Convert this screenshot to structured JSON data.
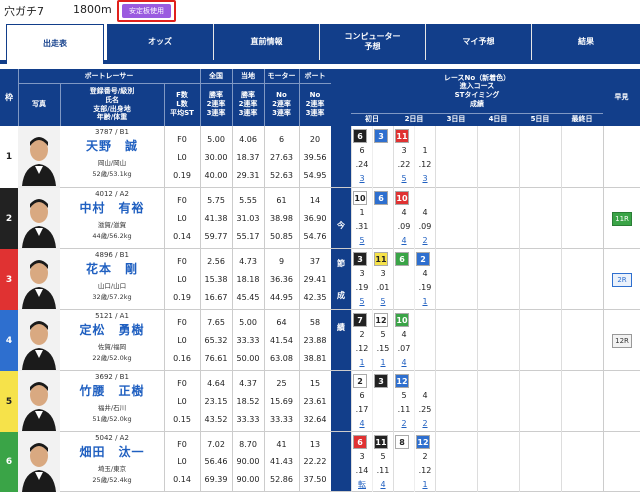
{
  "header": {
    "race_name": "穴ガチ7",
    "distance": "1800m",
    "badge": "安定板使用"
  },
  "tabs": [
    {
      "label": "出走表",
      "active": true
    },
    {
      "label": "オッズ"
    },
    {
      "label": "直前情報"
    },
    {
      "label": "コンピューター\n予想"
    },
    {
      "label": "マイ予想"
    },
    {
      "label": "結果"
    }
  ],
  "table_headers": {
    "waku": "枠",
    "boatracer": "ボートレーサー",
    "photo": "写真",
    "reg": "登録番号/級別\n氏名\n支部/出身地\n年齢/体重",
    "fl": "F数\nL数\n平均ST",
    "national": "全国",
    "local": "当地",
    "motor": "モーター",
    "boat": "ボート",
    "rate_labels": "勝率\n2連率\n3連率",
    "no_labels": "No\n2連率\n3連率",
    "race_info": "レースNo（新着色）\n進入コース\nSTタイミング\n成績",
    "days": [
      "初日",
      "2日目",
      "3日目",
      "4日目",
      "5日目",
      "最終日"
    ],
    "kon": "今",
    "setsu": "節",
    "seiseki": "成",
    "seki": "績",
    "early": "早見"
  },
  "racers": [
    {
      "lane": "1",
      "id": "3787 / B1",
      "name": "天野　誠",
      "region": "岡山/岡山",
      "body": "52歳/53.1kg",
      "fl": [
        "F0",
        "L0",
        "0.19"
      ],
      "national": [
        "5.00",
        "30.00",
        "40.00"
      ],
      "local": [
        "4.06",
        "18.37",
        "29.31"
      ],
      "motor": [
        "6",
        "27.63",
        "52.63"
      ],
      "boat": [
        "20",
        "39.56",
        "54.95"
      ],
      "lane_color": "#ffffff",
      "lane_text": "#222",
      "results": [
        [
          "6",
          "",
          ""
        ],
        [
          "3",
          "11"
        ]
      ],
      "row_early": ""
    },
    {
      "lane": "2",
      "id": "4012 / A2",
      "name": "中村　有裕",
      "region": "滋賀/滋賀",
      "body": "44歳/56.2kg",
      "fl": [
        "F0",
        "L0",
        "0.14"
      ],
      "national": [
        "5.75",
        "41.38",
        "59.77"
      ],
      "local": [
        "5.55",
        "31.03",
        "55.17"
      ],
      "motor": [
        "61",
        "38.98",
        "50.85"
      ],
      "boat": [
        "14",
        "36.90",
        "54.76"
      ],
      "lane_color": "#222222",
      "lane_text": "#fff",
      "row_early": "11R"
    },
    {
      "lane": "3",
      "id": "4896 / B1",
      "name": "花本　剛",
      "region": "山口/山口",
      "body": "32歳/57.2kg",
      "fl": [
        "F0",
        "L0",
        "0.19"
      ],
      "national": [
        "2.56",
        "15.38",
        "16.67"
      ],
      "local": [
        "4.73",
        "18.18",
        "45.45"
      ],
      "motor": [
        "9",
        "36.36",
        "44.95"
      ],
      "boat": [
        "37",
        "29.41",
        "42.35"
      ],
      "lane_color": "#e03232",
      "lane_text": "#fff",
      "row_early": "2R"
    },
    {
      "lane": "4",
      "id": "5121 / A1",
      "name": "定松　勇樹",
      "region": "佐賀/福岡",
      "body": "22歳/52.0kg",
      "fl": [
        "F0",
        "L0",
        "0.16"
      ],
      "national": [
        "7.65",
        "65.32",
        "76.61"
      ],
      "local": [
        "5.00",
        "33.33",
        "50.00"
      ],
      "motor": [
        "64",
        "41.54",
        "63.08"
      ],
      "boat": [
        "58",
        "23.88",
        "38.81"
      ],
      "lane_color": "#2e6fcf",
      "lane_text": "#fff",
      "row_early": "12R"
    },
    {
      "lane": "5",
      "id": "3692 / B1",
      "name": "竹腰　正樹",
      "region": "福井/石川",
      "body": "51歳/52.0kg",
      "fl": [
        "F0",
        "L0",
        "0.15"
      ],
      "national": [
        "4.64",
        "23.15",
        "43.52"
      ],
      "local": [
        "4.37",
        "18.52",
        "33.33"
      ],
      "motor": [
        "25",
        "15.69",
        "33.33"
      ],
      "boat": [
        "15",
        "23.61",
        "32.64"
      ],
      "lane_color": "#f6e24a",
      "lane_text": "#222",
      "row_early": ""
    },
    {
      "lane": "6",
      "id": "5042 / A2",
      "name": "畑田　汰一",
      "region": "埼玉/東京",
      "body": "25歳/52.4kg",
      "fl": [
        "F0",
        "L0",
        "0.14"
      ],
      "national": [
        "7.02",
        "56.46",
        "69.39"
      ],
      "local": [
        "8.70",
        "90.00",
        "90.00"
      ],
      "motor": [
        "41",
        "41.43",
        "52.86"
      ],
      "boat": [
        "13",
        "22.22",
        "37.50"
      ],
      "lane_color": "#3aa447",
      "lane_text": "#fff",
      "row_early": ""
    }
  ],
  "race_cells": [
    {
      "chips": [
        [
          "6",
          "#222",
          "#fff"
        ],
        [
          "3",
          "#2e6fcf",
          "#fff"
        ],
        [
          "11",
          "#e03232",
          "#fff"
        ]
      ],
      "courses": [
        "6",
        "",
        "3",
        "1"
      ],
      "sts": [
        ".24",
        "",
        ".22",
        ".12"
      ],
      "ranks": [
        "3",
        "",
        "5",
        "3"
      ]
    },
    {
      "chips": [
        [
          "10",
          "#fff",
          "#222"
        ],
        [
          "6",
          "#2e6fcf",
          "#fff"
        ],
        [
          "10",
          "#e03232",
          "#fff"
        ]
      ],
      "courses": [
        "1",
        "",
        "4",
        "4"
      ],
      "sts": [
        ".31",
        "",
        ".09",
        ".09"
      ],
      "ranks": [
        "5",
        "",
        "4",
        "2"
      ]
    },
    {
      "chips": [
        [
          "3",
          "#222",
          "#fff"
        ],
        [
          "11",
          "#f6e24a",
          "#222"
        ],
        [
          "6",
          "#3aa447",
          "#fff"
        ],
        [
          "2",
          "#2e6fcf",
          "#fff"
        ]
      ],
      "courses": [
        "3",
        "3",
        "",
        "4"
      ],
      "sts": [
        ".19",
        ".01",
        "",
        ".19"
      ],
      "ranks": [
        "5",
        "5",
        "",
        "1"
      ]
    },
    {
      "chips": [
        [
          "7",
          "#222",
          "#fff"
        ],
        [
          "12",
          "#fff",
          "#222"
        ],
        [
          "10",
          "#3aa447",
          "#fff"
        ]
      ],
      "courses": [
        "2",
        "5",
        "4",
        ""
      ],
      "sts": [
        ".12",
        ".15",
        ".07",
        ""
      ],
      "ranks": [
        "1",
        "1",
        "4",
        ""
      ]
    },
    {
      "chips": [
        [
          "2",
          "#fff",
          "#222"
        ],
        [
          "3",
          "#222",
          "#fff"
        ],
        [
          "12",
          "#2e6fcf",
          "#fff"
        ]
      ],
      "courses": [
        "6",
        "",
        "5",
        "4"
      ],
      "sts": [
        ".17",
        "",
        ".11",
        ".25"
      ],
      "ranks": [
        "4",
        "",
        "2",
        "2"
      ]
    },
    {
      "chips": [
        [
          "6",
          "#e03232",
          "#fff"
        ],
        [
          "11",
          "#222",
          "#fff"
        ],
        [
          "8",
          "#fff",
          "#222"
        ],
        [
          "12",
          "#2e6fcf",
          "#fff"
        ]
      ],
      "courses": [
        "3",
        "5",
        "",
        "2"
      ],
      "sts": [
        ".14",
        ".11",
        "",
        ".12"
      ],
      "ranks": [
        "転",
        "4",
        "",
        "1"
      ]
    }
  ]
}
